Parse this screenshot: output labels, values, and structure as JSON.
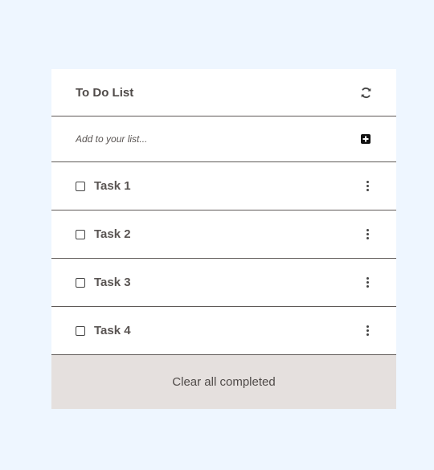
{
  "app": {
    "title": "To Do List",
    "refresh_icon": "refresh-icon",
    "add_icon": "plus-square-icon"
  },
  "add": {
    "placeholder": "Add to your list...",
    "value": ""
  },
  "tasks": [
    {
      "label": "Task 1",
      "checked": false
    },
    {
      "label": "Task 2",
      "checked": false
    },
    {
      "label": "Task 3",
      "checked": false
    },
    {
      "label": "Task 4",
      "checked": false
    }
  ],
  "footer": {
    "clear_label": "Clear all completed"
  },
  "colors": {
    "page_background": "#eef6ff",
    "card_background": "#ffffff",
    "footer_background": "#e5e0de",
    "text": "#4f4a48"
  }
}
